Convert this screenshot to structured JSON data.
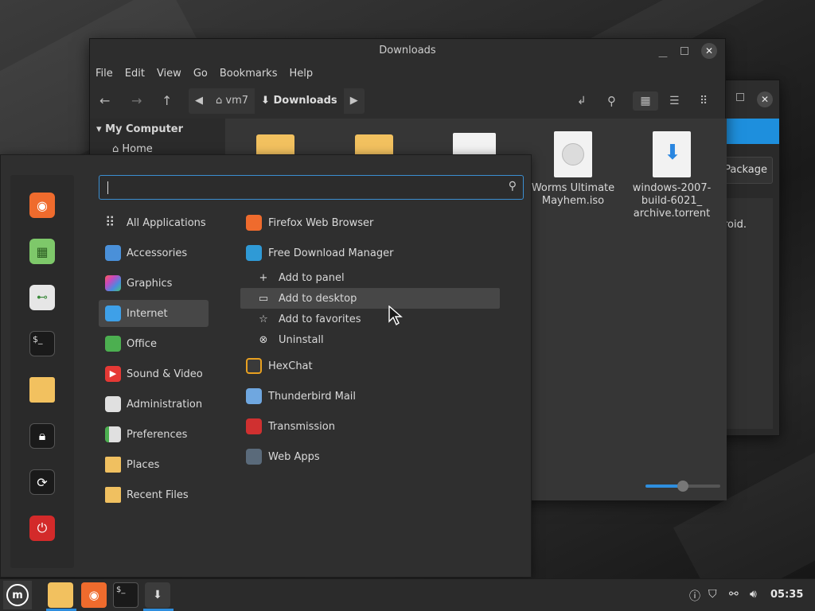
{
  "second_window": {
    "button_label": "Package",
    "body_text": "roid.",
    "close_glyph": "✕"
  },
  "file_manager": {
    "title": "Downloads",
    "close_glyph": "✕",
    "menu": [
      "File",
      "Edit",
      "View",
      "Go",
      "Bookmarks",
      "Help"
    ],
    "breadcrumb": {
      "home": "vm7",
      "current": "Downloads"
    },
    "sidebar": {
      "header": "My Computer",
      "items": [
        "Home"
      ]
    },
    "files": [
      {
        "name": "",
        "icon": "folder-icon"
      },
      {
        "name": "",
        "icon": "folder-icon"
      },
      {
        "name": "",
        "icon": "app-icon"
      },
      {
        "name": "Worms Ultimate Mayhem.iso",
        "icon": "disc-icon"
      },
      {
        "name": "windows-2007-build-6021_ archive.torrent",
        "icon": "torrent-icon"
      }
    ],
    "zoom_level": 0.5
  },
  "menu": {
    "search": {
      "value": "",
      "placeholder": ""
    },
    "favorites": [
      "firefox-icon",
      "sysmon-icon",
      "settings-icon",
      "terminal-icon",
      "files-icon",
      "lock-icon",
      "logout-icon",
      "power-icon"
    ],
    "categories": [
      {
        "label": "All Applications",
        "icon": "grid-icon",
        "color": "#cccccc"
      },
      {
        "label": "Accessories",
        "icon": "scissors-icon",
        "color": "#4a90d9"
      },
      {
        "label": "Graphics",
        "icon": "graphics-icon",
        "color": "#c44ac0"
      },
      {
        "label": "Internet",
        "icon": "cloud-icon",
        "color": "#3ea0e8"
      },
      {
        "label": "Office",
        "icon": "office-icon",
        "color": "#4caf50"
      },
      {
        "label": "Sound & Video",
        "icon": "play-icon",
        "color": "#e53935"
      },
      {
        "label": "Administration",
        "icon": "admin-icon",
        "color": "#e0e0e0"
      },
      {
        "label": "Preferences",
        "icon": "prefs-icon",
        "color": "#e0e0e0"
      },
      {
        "label": "Places",
        "icon": "folder-icon",
        "color": "#f0c060"
      },
      {
        "label": "Recent Files",
        "icon": "recent-icon",
        "color": "#f0c060"
      }
    ],
    "selected_category": "Internet",
    "apps": [
      {
        "label": "Firefox Web Browser",
        "icon": "firefox-icon",
        "color": "#ef6b2d"
      },
      {
        "label": "Free Download Manager",
        "icon": "fdm-icon",
        "color": "#2f9ad6"
      },
      {
        "label": "HexChat",
        "icon": "hexchat-icon",
        "color": "#3a3a3a"
      },
      {
        "label": "Thunderbird Mail",
        "icon": "mail-icon",
        "color": "#6fa7e0"
      },
      {
        "label": "Transmission",
        "icon": "transmission-icon",
        "color": "#d03030"
      },
      {
        "label": "Web Apps",
        "icon": "webapps-icon",
        "color": "#5a6a7a"
      }
    ],
    "context_menu": [
      {
        "label": "Add to panel",
        "glyph": "+"
      },
      {
        "label": "Add to desktop",
        "glyph": "▭"
      },
      {
        "label": "Add to favorites",
        "glyph": "☆"
      },
      {
        "label": "Uninstall",
        "glyph": "⊗"
      }
    ],
    "context_selected": "Add to desktop"
  },
  "panel": {
    "launchers": [
      "files-icon",
      "firefox-icon",
      "terminal-icon",
      "installer-icon"
    ],
    "tray": [
      "update-icon",
      "shield-icon",
      "network-icon",
      "volume-icon"
    ],
    "clock": "05:35"
  },
  "colors": {
    "accent": "#2e8ede",
    "selection": "#474747"
  }
}
